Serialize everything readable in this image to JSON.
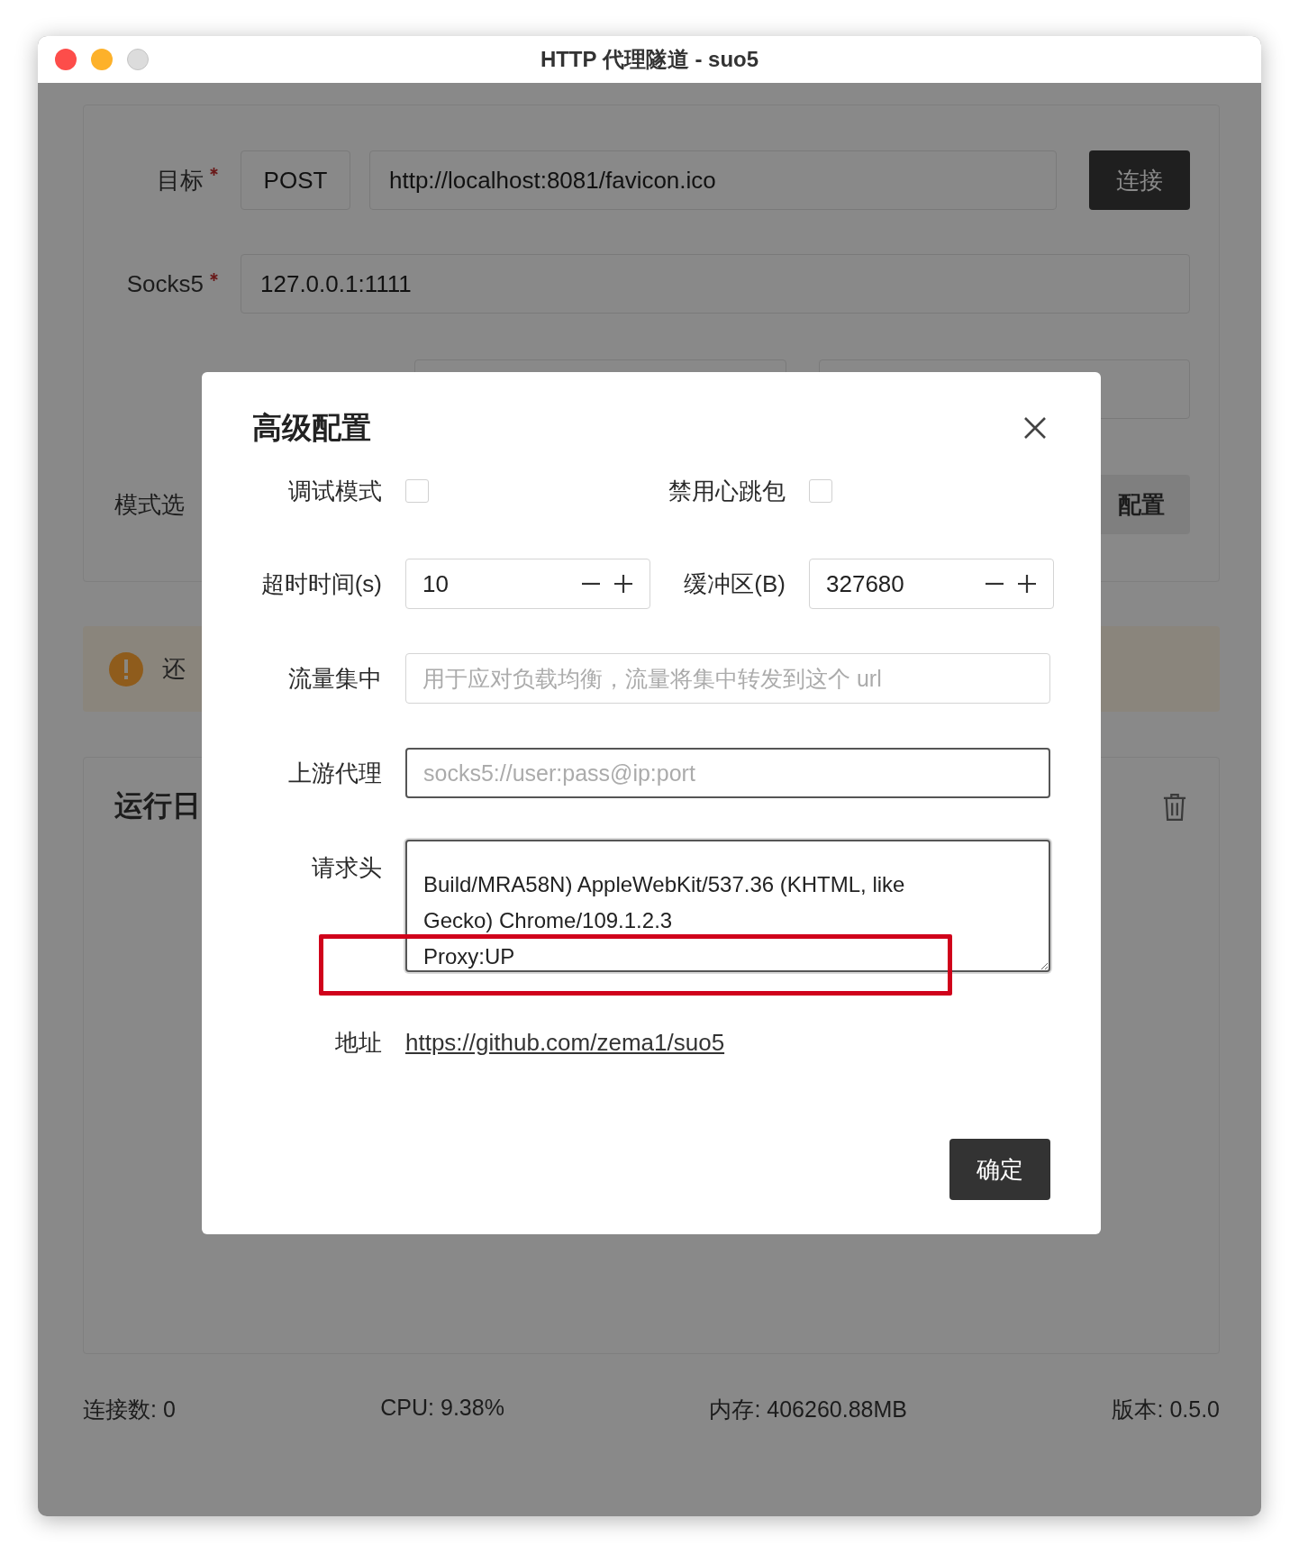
{
  "window": {
    "title": "HTTP 代理隧道 - suo5"
  },
  "form": {
    "target": {
      "label": "目标",
      "required": true,
      "method": "POST",
      "url": "http://localhost:8081/favicon.ico",
      "connect_button": "连接"
    },
    "socks5": {
      "label": "Socks5",
      "required": true,
      "value": "127.0.0.1:1111"
    },
    "mode": {
      "label": "模式选",
      "advanced_button": "配置"
    }
  },
  "alert": {
    "text": "还"
  },
  "log": {
    "title": "运行日"
  },
  "status_bar": [
    "连接数: 0",
    "CPU: 9.38%",
    "内存: 406260.88MB",
    "版本: 0.5.0"
  ],
  "dialog": {
    "title": "高级配置",
    "checkboxes": [
      {
        "label": "调试模式",
        "checked": false
      },
      {
        "label": "禁用心跳包",
        "checked": false
      }
    ],
    "numbers": [
      {
        "label": "超时时间(s)",
        "value": "10"
      },
      {
        "label": "缓冲区(B)",
        "value": "327680"
      }
    ],
    "fields": [
      {
        "label": "流量集中",
        "placeholder": "用于应对负载均衡，流量将集中转发到这个 url",
        "focused": false
      },
      {
        "label": "上游代理",
        "placeholder": "socks5://user:pass@ip:port",
        "focused": true
      }
    ],
    "headers": {
      "label": "请求头",
      "lines": [
        "Build/MRA58N) AppleWebKit/537.36 (KHTML, like",
        "Gecko) Chrome/109.1.2.3",
        "Proxy:UP"
      ]
    },
    "address": {
      "label": "地址",
      "link": "https://github.com/zema1/suo5"
    },
    "ok_button": "确定"
  }
}
